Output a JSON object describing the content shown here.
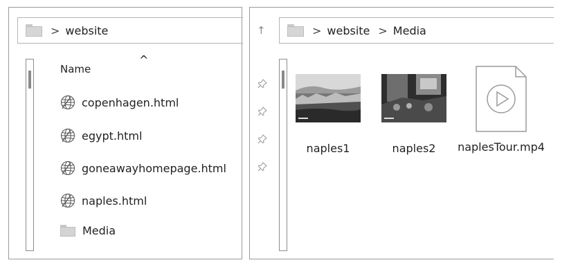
{
  "left_pane": {
    "breadcrumb": {
      "separator": ">",
      "items": [
        "website"
      ]
    },
    "column_header": "Name",
    "sort_indicator": "^",
    "files": [
      {
        "name": "copenhagen.html",
        "icon": "html-file-icon"
      },
      {
        "name": "egypt.html",
        "icon": "html-file-icon"
      },
      {
        "name": "goneawayhomepage.html",
        "icon": "html-file-icon"
      },
      {
        "name": "naples.html",
        "icon": "html-file-icon"
      }
    ],
    "folders": [
      {
        "name": "Media",
        "icon": "folder-icon"
      }
    ]
  },
  "right_pane": {
    "up_button": "↑",
    "breadcrumb": {
      "separator": ">",
      "items": [
        "website",
        "Media"
      ]
    },
    "items": [
      {
        "name": "naples1",
        "icon": "image-thumbnail"
      },
      {
        "name": "naples2",
        "icon": "image-thumbnail"
      },
      {
        "name": "naplesTour.mp4",
        "icon": "video-file-icon"
      }
    ]
  }
}
